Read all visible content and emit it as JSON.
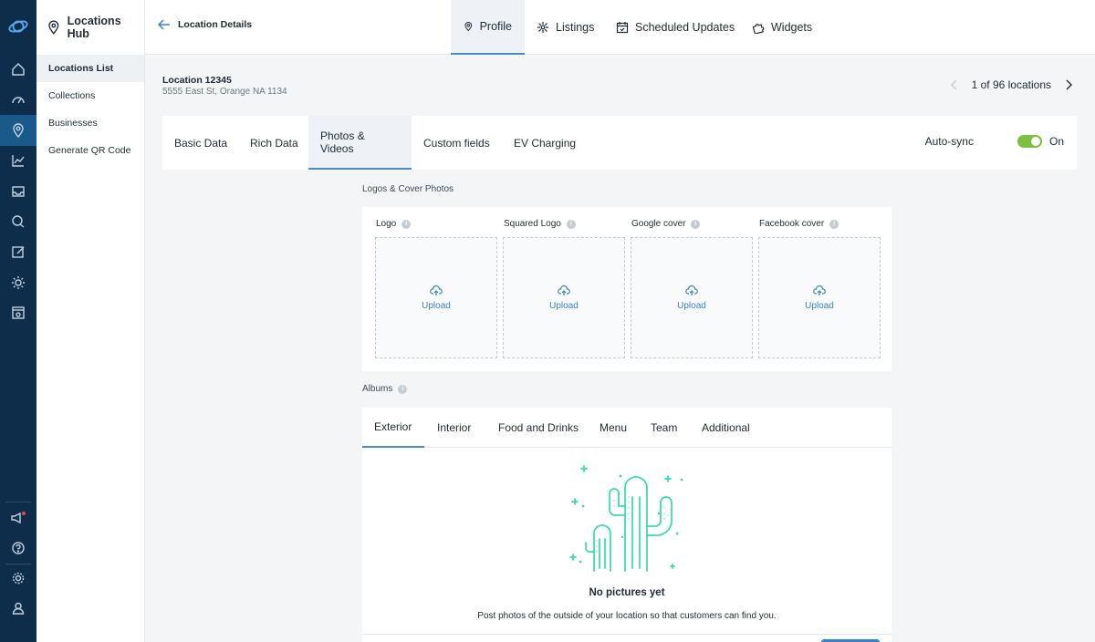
{
  "app": {
    "module_title": "Locations Hub",
    "back_label": "Location Details"
  },
  "rail": {
    "icons": [
      "logo-icon",
      "home-icon",
      "dashboard-icon",
      "location-icon",
      "analytics-icon",
      "inbox-icon",
      "chat-icon",
      "edit-icon",
      "ideas-icon",
      "browser-icon",
      "announcement-icon",
      "help-icon",
      "settings-icon",
      "user-icon"
    ],
    "active": "location-icon"
  },
  "sidebar": {
    "items": [
      {
        "label": "Locations List",
        "active": true
      },
      {
        "label": "Collections",
        "active": false
      },
      {
        "label": "Businesses",
        "active": false
      },
      {
        "label": "Generate QR Code",
        "active": false
      }
    ]
  },
  "top_tabs": [
    {
      "label": "Profile",
      "icon": "profile-pin-icon",
      "active": true
    },
    {
      "label": "Listings",
      "icon": "network-icon",
      "active": false
    },
    {
      "label": "Scheduled Updates",
      "icon": "calendar-icon",
      "active": false
    },
    {
      "label": "Widgets",
      "icon": "puzzle-icon",
      "active": false
    }
  ],
  "location": {
    "name": "Location 12345",
    "address": "5555 East St, Orange NA 1134",
    "pager_text": "1 of 96 locations"
  },
  "section_tabs": [
    {
      "label": "Basic Data",
      "active": false
    },
    {
      "label": "Rich Data",
      "active": false
    },
    {
      "label": "Photos & Videos",
      "active": true
    },
    {
      "label": "Custom fields",
      "active": false
    },
    {
      "label": "EV Charging",
      "active": false
    }
  ],
  "autosync": {
    "label": "Auto-sync",
    "state": "On",
    "enabled": true,
    "color": "#7bc043"
  },
  "logos": {
    "title": "Logos & Cover Photos",
    "slots": [
      {
        "label": "Logo",
        "upload": "Upload"
      },
      {
        "label": "Squared Logo",
        "upload": "Upload"
      },
      {
        "label": "Google cover",
        "upload": "Upload"
      },
      {
        "label": "Facebook cover",
        "upload": "Upload"
      }
    ]
  },
  "albums": {
    "title": "Albums",
    "tabs": [
      {
        "label": "Exterior",
        "active": true
      },
      {
        "label": "Interior",
        "active": false
      },
      {
        "label": "Food and Drinks",
        "active": false
      },
      {
        "label": "Menu",
        "active": false
      },
      {
        "label": "Team",
        "active": false
      },
      {
        "label": "Additional",
        "active": false
      }
    ],
    "empty_title": "No pictures yet",
    "empty_desc": "Post photos of the outside of your location so that customers can find you."
  },
  "colors": {
    "accent": "#4a8cc7",
    "rail": "#0d2d4a",
    "illustration": "#3ddab4"
  }
}
